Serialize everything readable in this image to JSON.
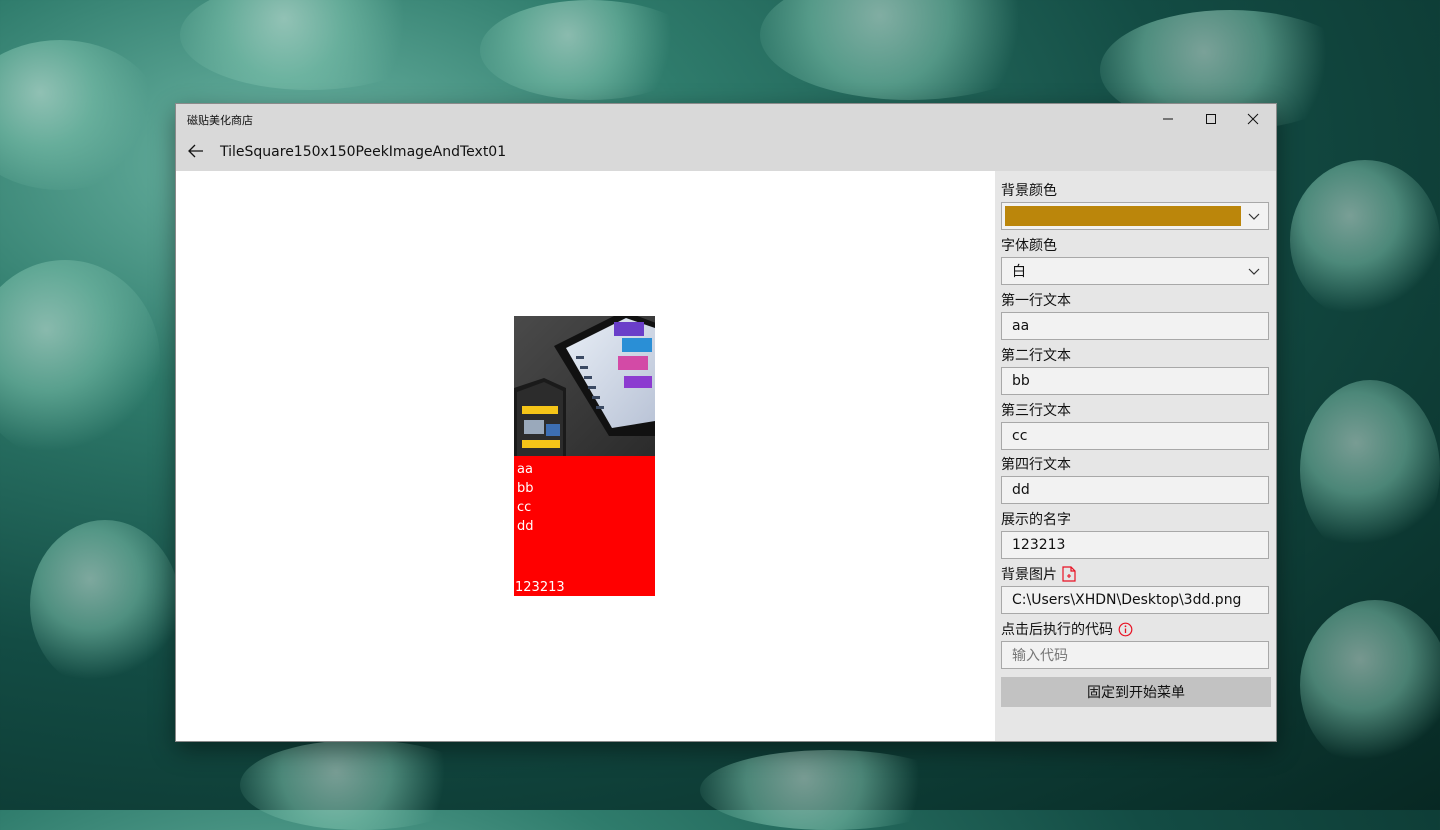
{
  "colors": {
    "accent_bg": "#bb860b",
    "tile_bg": "#ff0000",
    "tile_text": "#ffffff",
    "error_icon": "#e81123"
  },
  "window": {
    "title": "磁贴美化商店",
    "page_heading": "TileSquare150x150PeekImageAndText01",
    "icons": [
      "minimize-icon",
      "maximize-icon",
      "close-icon",
      "back-arrow-icon"
    ]
  },
  "tile": {
    "lines": [
      "aa",
      "bb",
      "cc",
      "dd"
    ],
    "name": "123213"
  },
  "form": {
    "background_color_label": "背景颜色",
    "font_color_label": "字体颜色",
    "font_color_value": "白",
    "line1_label": "第一行文本",
    "line1_value": "aa",
    "line2_label": "第二行文本",
    "line2_value": "bb",
    "line3_label": "第三行文本",
    "line3_value": "cc",
    "line4_label": "第四行文本",
    "line4_value": "dd",
    "display_name_label": "展示的名字",
    "display_name_value": "123213",
    "bg_image_label": "背景图片",
    "bg_image_value": "C:\\Users\\XHDN\\Desktop\\3dd.png",
    "code_label": "点击后执行的代码",
    "code_placeholder": "输入代码",
    "pin_button": "固定到开始菜单"
  }
}
